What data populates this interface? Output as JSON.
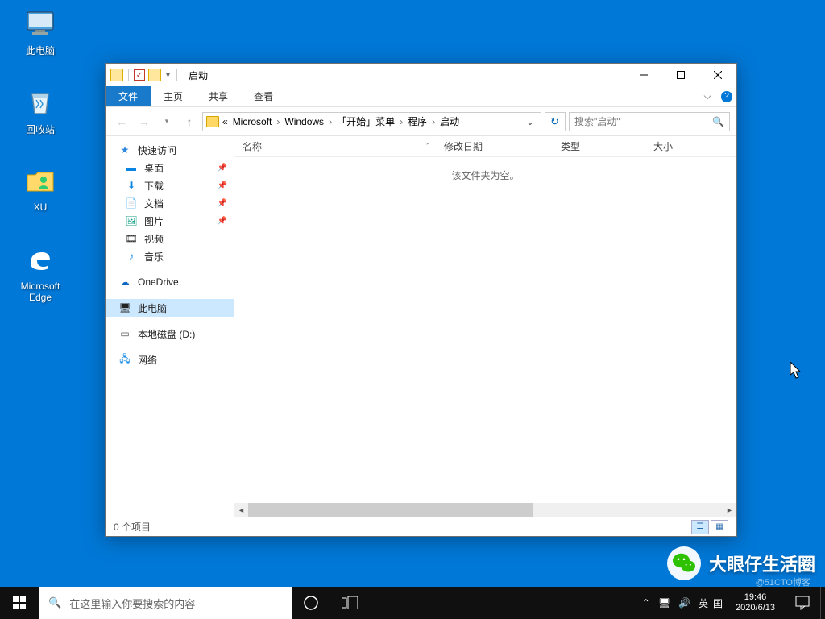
{
  "desktop_icons": {
    "this_pc": "此电脑",
    "recycle_bin": "回收站",
    "xu_folder": "XU",
    "edge": "Microsoft\nEdge"
  },
  "explorer": {
    "title": "启动",
    "ribbon": {
      "file": "文件",
      "home": "主页",
      "share": "共享",
      "view": "查看"
    },
    "breadcrumb": {
      "overflow": "«",
      "parts": [
        "Microsoft",
        "Windows",
        "「开始」菜单",
        "程序",
        "启动"
      ]
    },
    "search_placeholder": "搜索\"启动\"",
    "nav": {
      "quick_access": "快速访问",
      "desktop": "桌面",
      "downloads": "下载",
      "documents": "文档",
      "pictures": "图片",
      "videos": "视频",
      "music": "音乐",
      "onedrive": "OneDrive",
      "this_pc": "此电脑",
      "local_disk_d": "本地磁盘 (D:)",
      "network": "网络"
    },
    "columns": {
      "name": "名称",
      "date": "修改日期",
      "type": "类型",
      "size": "大小"
    },
    "empty_text": "该文件夹为空。",
    "status": "0 个项目"
  },
  "taskbar": {
    "search_placeholder": "在这里输入你要搜索的内容",
    "ime_lang": "英",
    "ime_full": "囯",
    "time": "19:46",
    "date": "2020/6/13"
  },
  "watermark": {
    "text": "大眼仔生活圈",
    "faint": "@51CTO博客"
  }
}
